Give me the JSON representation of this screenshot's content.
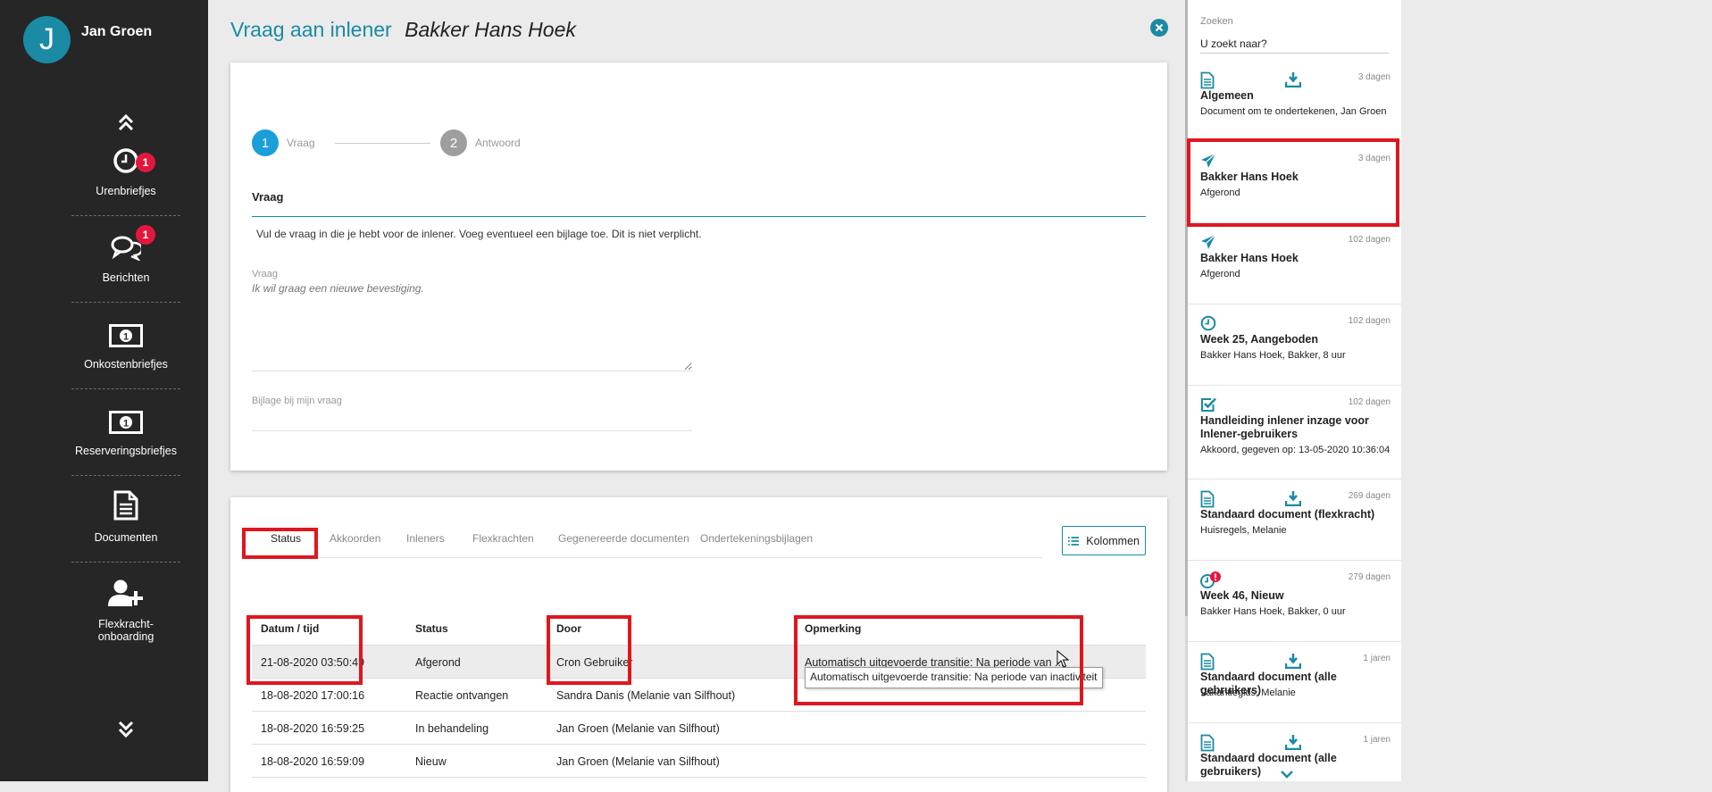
{
  "user": {
    "initial": "J",
    "name": "Jan Groen"
  },
  "sidebar": {
    "items": [
      {
        "label": "Urenbriefjes",
        "icon": "clock-icon",
        "badge": "1"
      },
      {
        "label": "Berichten",
        "icon": "chat-bubbles-icon",
        "badge": "1"
      },
      {
        "label": "Onkostenbriefjes",
        "icon": "banknote-icon"
      },
      {
        "label": "Reserveringsbriefjes",
        "icon": "banknote-icon"
      },
      {
        "label": "Documenten",
        "icon": "document-icon"
      },
      {
        "label": "Flexkracht-onboarding",
        "icon": "add-user-icon"
      }
    ]
  },
  "page": {
    "title_prefix": "Vraag aan inlener",
    "title_subject": "Bakker Hans Hoek"
  },
  "steps": [
    {
      "number": "1",
      "label": "Vraag",
      "color": "#1a9fd9"
    },
    {
      "number": "2",
      "label": "Antwoord",
      "color": "#9e9e9e"
    }
  ],
  "form": {
    "section_title": "Vraag",
    "instruction": "Vul de vraag in die je hebt voor de inlener. Voeg eventueel een bijlage toe. Dit is niet verplicht.",
    "question_label": "Vraag",
    "question_placeholder": "Ik wil graag een nieuwe bevestiging.",
    "attachment_label": "Bijlage bij mijn vraag"
  },
  "tabs": [
    "Status",
    "Akkoorden",
    "Inleners",
    "Flexkrachten",
    "Gegenereerde documenten",
    "Ondertekeningsbijlagen"
  ],
  "kolommen_label": "Kolommen",
  "table": {
    "headers": [
      "Datum / tijd",
      "Status",
      "Door",
      "Opmerking"
    ],
    "rows": [
      [
        "21-08-2020 03:50:49",
        "Afgerond",
        "Cron Gebruiker",
        "Automatisch uitgevoerde transitie: Na periode van ..."
      ],
      [
        "18-08-2020 17:00:16",
        "Reactie ontvangen",
        "Sandra Danis (Melanie van Silfhout)",
        ""
      ],
      [
        "18-08-2020 16:59:25",
        "In behandeling",
        "Jan Groen (Melanie van Silfhout)",
        ""
      ],
      [
        "18-08-2020 16:59:09",
        "Nieuw",
        "Jan Groen (Melanie van Silfhout)",
        ""
      ]
    ],
    "tooltip": "Automatisch uitgevoerde transitie: Na periode van inactiviteit"
  },
  "search": {
    "label": "Zoeken",
    "placeholder": "U zoekt naar?"
  },
  "feed": [
    {
      "icon": "document-icon",
      "download": true,
      "time": "3 dagen",
      "title": "Algemeen",
      "subtitle": "Document om te ondertekenen, Jan Groen"
    },
    {
      "icon": "paper-plane-icon",
      "download": false,
      "time": "3 dagen",
      "title": "Bakker Hans Hoek",
      "subtitle": "Afgerond"
    },
    {
      "icon": "paper-plane-icon",
      "download": false,
      "time": "102 dagen",
      "title": "Bakker Hans Hoek",
      "subtitle": "Afgerond"
    },
    {
      "icon": "clock-icon",
      "download": false,
      "time": "102 dagen",
      "title": "Week 25, Aangeboden",
      "subtitle": "Bakker Hans Hoek, Bakker, 8 uur"
    },
    {
      "icon": "checkbox-icon",
      "download": false,
      "time": "102 dagen",
      "title": "Handleiding inlener inzage voor Inlener-gebruikers",
      "subtitle": "Akkoord, gegeven op: 13-05-2020 10:36:04"
    },
    {
      "icon": "document-icon",
      "download": true,
      "time": "269 dagen",
      "title": "Standaard document (flexkracht)",
      "subtitle": "Huisregels, Melanie"
    },
    {
      "icon": "clock-alert-icon",
      "download": false,
      "time": "279 dagen",
      "title": "Week 46, Nieuw",
      "subtitle": "Bakker Hans Hoek, Bakker, 0 uur"
    },
    {
      "icon": "document-icon",
      "download": true,
      "time": "1 jaren",
      "title": "Standaard document (alle gebruikers)",
      "subtitle": "Vakantiegids, Melanie"
    },
    {
      "icon": "document-icon",
      "download": true,
      "time": "1 jaren",
      "title": "Standaard document (alle gebruikers)",
      "subtitle": ""
    }
  ],
  "colors": {
    "accent": "#1a8aa5",
    "sidebar_bg": "#262626",
    "badge": "#e3173e",
    "highlight_box": "#e0161f"
  }
}
